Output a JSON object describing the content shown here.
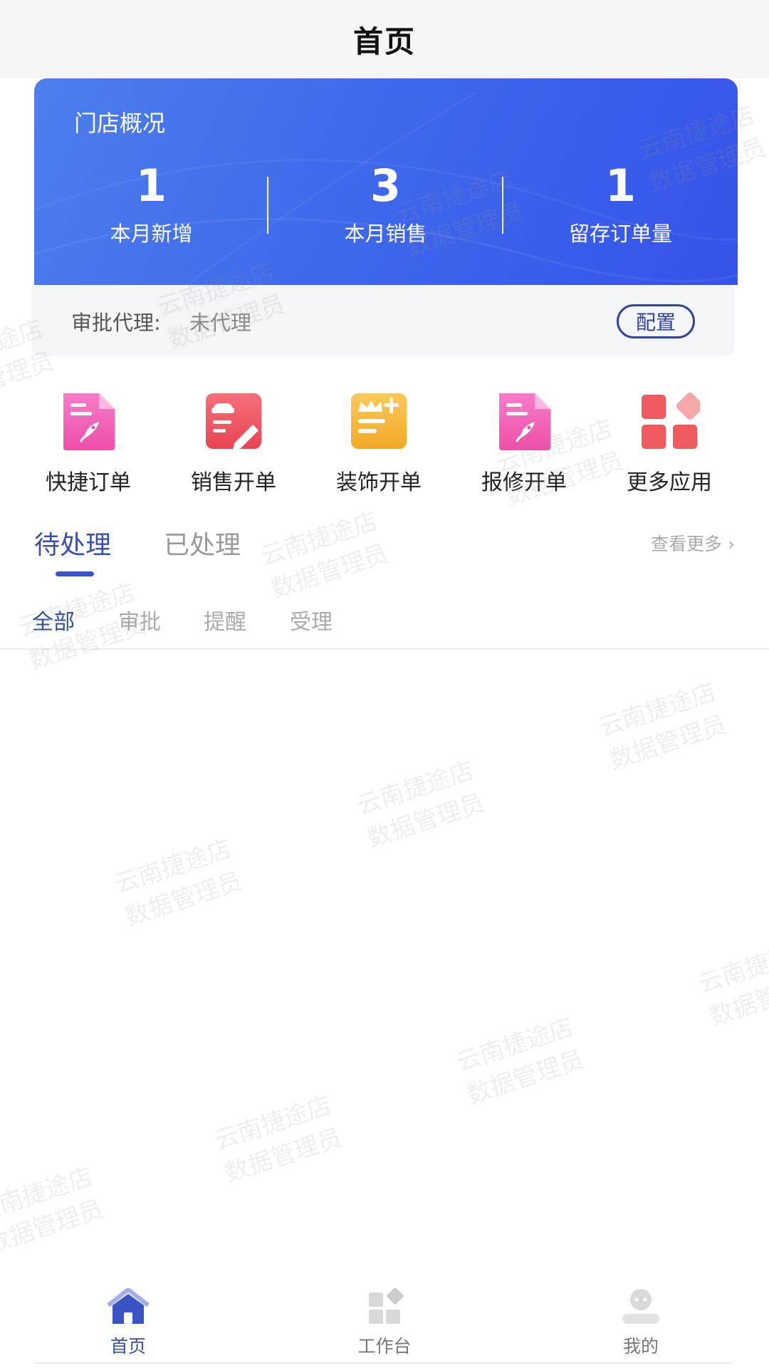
{
  "header": {
    "title": "首页"
  },
  "store_card": {
    "title": "门店概况",
    "stats": [
      {
        "value": "1",
        "label": "本月新增"
      },
      {
        "value": "3",
        "label": "本月销售"
      },
      {
        "value": "1",
        "label": "留存订单量"
      }
    ]
  },
  "agent": {
    "label": "审批代理:",
    "value": "未代理",
    "config_button": "配置"
  },
  "apps": [
    {
      "label": "快捷订单",
      "icon": "pink-rocket-document-icon"
    },
    {
      "label": "销售开单",
      "icon": "red-car-edit-icon"
    },
    {
      "label": "装饰开单",
      "icon": "yellow-crown-plus-icon"
    },
    {
      "label": "报修开单",
      "icon": "pink-rocket-document-icon"
    },
    {
      "label": "更多应用",
      "icon": "red-grid-icon"
    }
  ],
  "tasks": {
    "tabs": [
      "待处理",
      "已处理"
    ],
    "active_tab": "待处理",
    "more_link": "查看更多",
    "filters": [
      "全部",
      "审批",
      "提醒",
      "受理"
    ],
    "active_filter": "全部"
  },
  "watermark": {
    "line1": "云南捷途店",
    "line2": "数据管理员"
  },
  "bottom_nav": [
    {
      "label": "首页",
      "icon": "home-icon",
      "active": true
    },
    {
      "label": "工作台",
      "icon": "workbench-icon",
      "active": false
    },
    {
      "label": "我的",
      "icon": "profile-icon",
      "active": false
    }
  ],
  "colors": {
    "accent": "#3a4fa5",
    "card_blue": "#3f69ec",
    "pink": "#f25fb4",
    "red": "#ef5a5e",
    "yellow": "#f6b73c"
  }
}
